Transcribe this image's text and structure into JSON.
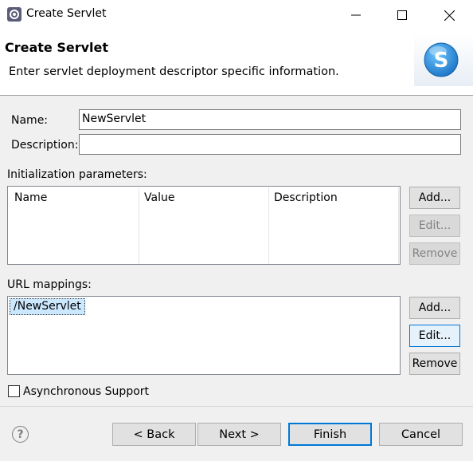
{
  "window": {
    "title": "Create Servlet",
    "minimize_glyph": "—",
    "maximize_glyph": "☐",
    "close_glyph": "✕"
  },
  "banner": {
    "title": "Create Servlet",
    "description": "Enter servlet deployment descriptor specific information.",
    "logo_letter": "S"
  },
  "form": {
    "name_label": "Name:",
    "name_value": "NewServlet",
    "description_label": "Description:",
    "description_value": ""
  },
  "init_params": {
    "label": "Initialization parameters:",
    "columns": [
      "Name",
      "Value",
      "Description"
    ],
    "rows": [],
    "buttons": {
      "add": "Add...",
      "edit": "Edit...",
      "remove": "Remove"
    }
  },
  "url_mappings": {
    "label": "URL mappings:",
    "items": [
      "/NewServlet"
    ],
    "buttons": {
      "add": "Add...",
      "edit": "Edit...",
      "remove": "Remove"
    }
  },
  "async": {
    "label": "Asynchronous Support",
    "checked": false
  },
  "footer": {
    "help_glyph": "?",
    "back": "< Back",
    "next": "Next >",
    "finish": "Finish",
    "cancel": "Cancel"
  },
  "colors": {
    "selection": "#cce8ff",
    "focus_border": "#0078d7",
    "logo_blue": "#1a8fd8"
  },
  "icons": {
    "app": "eclipse-gear-icon",
    "logo": "servlet-s-icon",
    "help": "help-icon"
  }
}
